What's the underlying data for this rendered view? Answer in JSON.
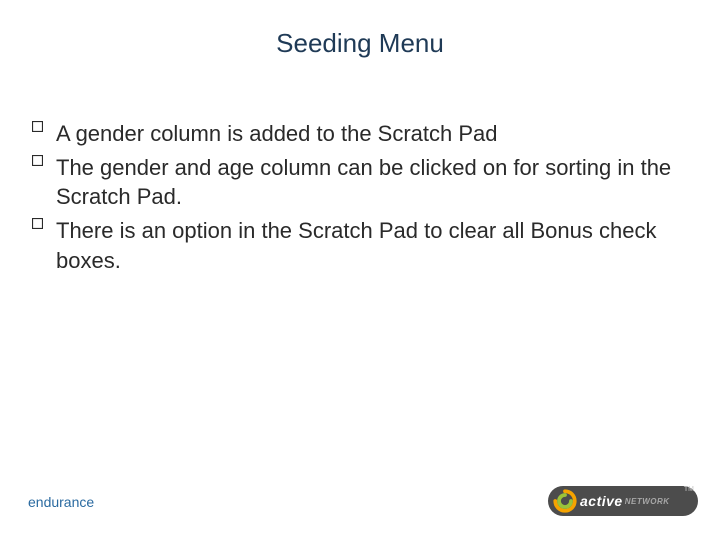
{
  "title": "Seeding Menu",
  "bullets": [
    "A gender column is added to the Scratch Pad",
    "The gender and age column can be clicked on for sorting in the Scratch Pad.",
    "There is an option in the Scratch Pad to clear all Bonus check boxes."
  ],
  "footer_label": "endurance",
  "logo": {
    "wordmark": "active",
    "sub": "NETWORK",
    "tm": "TM"
  },
  "colors": {
    "title": "#1f3a56",
    "footer": "#2a6aa0",
    "logo_bg": "#4c4c4c"
  }
}
